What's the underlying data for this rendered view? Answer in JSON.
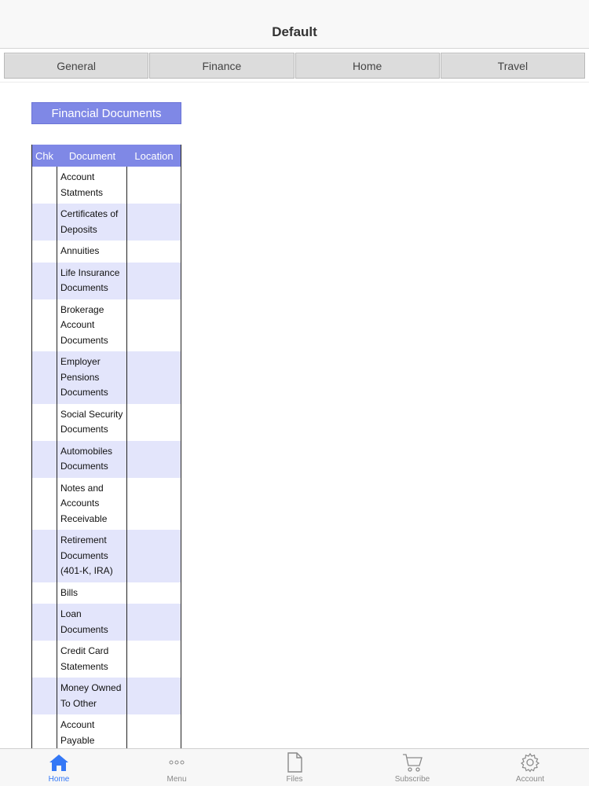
{
  "navbar": {
    "title": "Default"
  },
  "tabs": [
    {
      "label": "General"
    },
    {
      "label": "Finance"
    },
    {
      "label": "Home"
    },
    {
      "label": "Travel"
    }
  ],
  "section": {
    "title": "Financial Documents"
  },
  "table": {
    "headers": {
      "chk": "Chk",
      "document": "Document",
      "location": "Location"
    },
    "rows": [
      {
        "document": "Account Statments",
        "location": ""
      },
      {
        "document": "Certificates of Deposits",
        "location": ""
      },
      {
        "document": "Annuities",
        "location": ""
      },
      {
        "document": "Life Insurance Documents",
        "location": ""
      },
      {
        "document": "Brokerage Account Documents",
        "location": ""
      },
      {
        "document": "Employer Pensions Documents",
        "location": ""
      },
      {
        "document": "Social Security Documents",
        "location": ""
      },
      {
        "document": "Automobiles Documents",
        "location": ""
      },
      {
        "document": "Notes and Accounts Receivable",
        "location": ""
      },
      {
        "document": "Retirement Documents (401-K, IRA)",
        "location": ""
      },
      {
        "document": "Bills",
        "location": ""
      },
      {
        "document": "Loan Documents",
        "location": ""
      },
      {
        "document": "Credit Card Statements",
        "location": ""
      },
      {
        "document": "Money Owned To Other",
        "location": ""
      },
      {
        "document": "Account Payable",
        "location": ""
      }
    ]
  },
  "tabbar": [
    {
      "label": "Home",
      "icon": "home-icon",
      "active": true
    },
    {
      "label": "Menu",
      "icon": "more-dots-icon",
      "active": false
    },
    {
      "label": "Files",
      "icon": "file-icon",
      "active": false
    },
    {
      "label": "Subscribe",
      "icon": "cart-icon",
      "active": false
    },
    {
      "label": "Account",
      "icon": "gear-icon",
      "active": false
    }
  ],
  "colors": {
    "accent": "#7f88e6",
    "row_alt": "#e3e5fb",
    "active_tab": "#3478f6"
  }
}
